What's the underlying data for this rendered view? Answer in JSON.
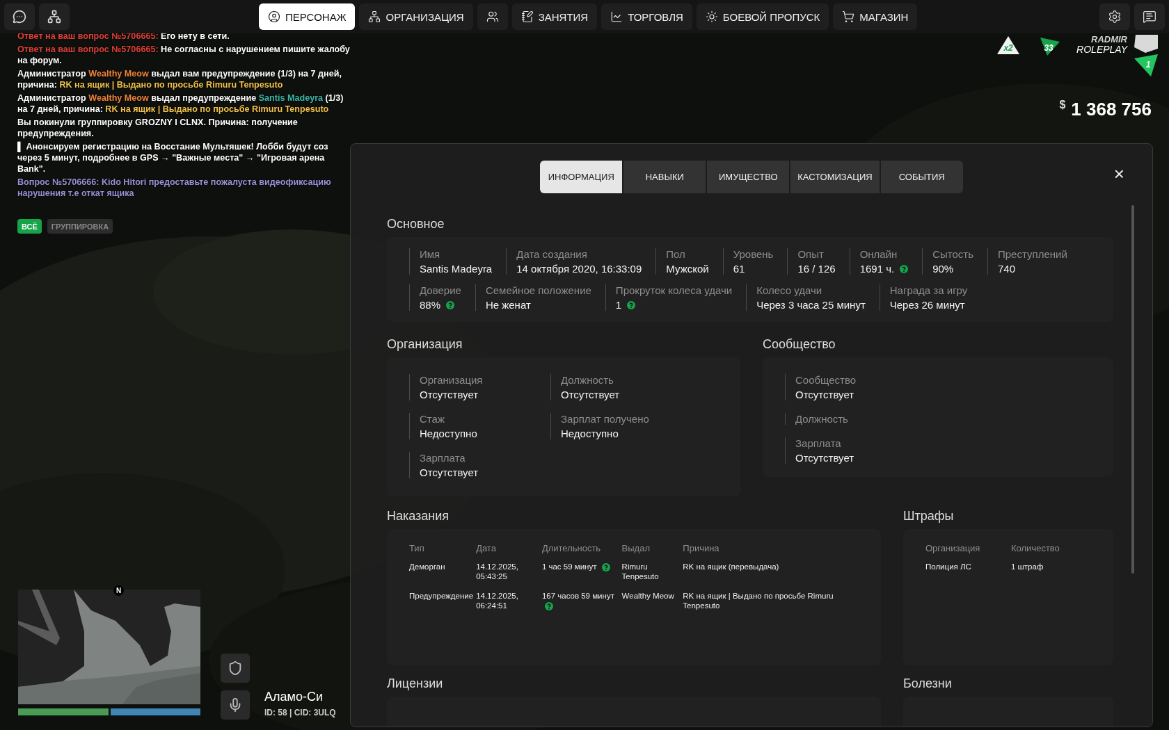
{
  "top_bar": {
    "nav": [
      {
        "label": "ПЕРСОНАЖ",
        "selected": true
      },
      {
        "label": "ОРГАНИЗАЦИЯ",
        "selected": false
      },
      {
        "selected": false
      },
      {
        "label": "ЗАНЯТИЯ",
        "selected": false
      },
      {
        "label": "ТОРГОВЛЯ",
        "selected": false
      },
      {
        "label": "БОЕВОЙ ПРОПУСК",
        "selected": false
      },
      {
        "label": "МАГАЗИН",
        "selected": false
      }
    ]
  },
  "chat": {
    "messages": [
      {
        "lines": [
          [
            {
              "text": "Ответ на ваш вопрос №5706665:",
              "color": "#e0403a"
            },
            {
              "text": " Его нету в сети.",
              "color": "#ffffff"
            }
          ]
        ]
      },
      {
        "lines": [
          [
            {
              "text": "Ответ на ваш вопрос №5706665:",
              "color": "#e0403a"
            },
            {
              "text": " Не согласны с нарушением пишите жалобу",
              "color": "#ffffff"
            }
          ],
          [
            {
              "text": "на форум.",
              "color": "#ffffff"
            }
          ]
        ]
      },
      {
        "lines": [
          [
            {
              "text": "Администратор ",
              "color": "#ffffff"
            },
            {
              "text": "Wealthy Meow",
              "color": "#f0823a"
            },
            {
              "text": " выдал вам предупреждение (1/3) на 7 дней,",
              "color": "#ffffff"
            }
          ],
          [
            {
              "text": "причина: ",
              "color": "#ffffff"
            },
            {
              "text": "RK на ящик | Выдано по просьбе Rimuru Tenpesuto",
              "color": "#f2c14a"
            }
          ]
        ]
      },
      {
        "lines": [
          [
            {
              "text": "Администратор ",
              "color": "#ffffff"
            },
            {
              "text": "Wealthy Meow",
              "color": "#f0823a"
            },
            {
              "text": " выдал предупреждение ",
              "color": "#ffffff"
            },
            {
              "text": "Santis Madeyra",
              "color": "#3bb7a4"
            },
            {
              "text": " (1/3)",
              "color": "#ffffff"
            }
          ],
          [
            {
              "text": "на 7 дней, причина: ",
              "color": "#ffffff"
            },
            {
              "text": "RK на ящик | Выдано по просьбе Rimuru Tenpesuto",
              "color": "#f2c14a"
            }
          ]
        ]
      },
      {
        "lines": [
          [
            {
              "text": "Вы покинули группировку GROZNY I CLNX. Причина: получение",
              "color": "#ffffff"
            }
          ],
          [
            {
              "text": "предупреждения.",
              "color": "#ffffff"
            }
          ]
        ]
      },
      {
        "lines": [
          [
            {
              "text": "▌ Анонсируем регистрацию на Восстание Мультяшек! Лобби будут соз",
              "color": "#ffffff"
            }
          ],
          [
            {
              "text": "через 5 минут, подробнее в GPS → \"Важные места\" → \"Игровая арена",
              "color": "#ffffff"
            }
          ],
          [
            {
              "text": "Bank\".",
              "color": "#ffffff"
            }
          ]
        ]
      },
      {
        "lines": [
          [
            {
              "text": "Вопрос №5706666: Kido Hitori предоставьте пожалуста видеофиксацию",
              "color": "#9b8fd6"
            }
          ],
          [
            {
              "text": "нарушения т.е откат ящика",
              "color": "#9b8fd6"
            }
          ]
        ]
      }
    ],
    "filters": [
      {
        "label": "ВСЁ",
        "selected": true
      },
      {
        "label": "ГРУППИРОВКА",
        "selected": false
      }
    ]
  },
  "server": {
    "bonus": "x2",
    "online": "33",
    "brand": "RADMIR",
    "brand_sub": "ROLEPLAY",
    "server_number": "1"
  },
  "money": {
    "currency": "$",
    "amount": "1 368 756"
  },
  "panel": {
    "tabs": [
      {
        "label": "ИНФОРМАЦИЯ",
        "selected": true
      },
      {
        "label": "НАВЫКИ",
        "selected": false
      },
      {
        "label": "ИМУЩЕСТВО",
        "selected": false
      },
      {
        "label": "КАСТОМИЗАЦИЯ",
        "selected": false
      },
      {
        "label": "СОБЫТИЯ",
        "selected": false
      }
    ],
    "close": "×",
    "main": {
      "title": "Основное",
      "lines": [
        {
          "fields": [
            {
              "label": "Имя",
              "value": "Santis Madeyra",
              "hint": false
            },
            {
              "label": "Дата создания",
              "value": "14 октября 2020, 16:33:09",
              "hint": false
            },
            {
              "label": "Пол",
              "value": "Мужской",
              "hint": false
            },
            {
              "label": "Уровень",
              "value": "61",
              "hint": false
            },
            {
              "label": "Опыт",
              "value": "16 / 126",
              "hint": false
            },
            {
              "label": "Онлайн",
              "value": "1691 ч.",
              "hint": true
            },
            {
              "label": "Сытость",
              "value": "90%",
              "hint": false
            },
            {
              "label": "Преступлений",
              "value": "740",
              "hint": false
            }
          ]
        },
        {
          "fields": [
            {
              "label": "Доверие",
              "value": "88%",
              "hint": true
            },
            {
              "label": "Семейное положение",
              "value": "Не женат",
              "hint": false
            },
            {
              "label": "Прокруток колеса удачи",
              "value": "1",
              "hint": true
            },
            {
              "label": "Колесо удачи",
              "value": "Через 3 часа 25 минут",
              "hint": false
            },
            {
              "label": "Награда за игру",
              "value": "Через 26 минут",
              "hint": false
            }
          ]
        }
      ]
    },
    "organization": {
      "title": "Организация",
      "fields": [
        {
          "label": "Организация",
          "value": "Отсутствует"
        },
        {
          "label": "Должность",
          "value": "Отсутствует"
        },
        {
          "label": "Стаж",
          "value": "Недоступно"
        },
        {
          "label": "Зарплат получено",
          "value": "Недоступно"
        },
        {
          "label": "Зарплата",
          "value": "Отсутствует"
        }
      ]
    },
    "community": {
      "title": "Сообщество",
      "fields": [
        {
          "label": "Сообщество",
          "value": "Отсутствует"
        },
        {
          "label": "Должность"
        },
        {
          "label": "Зарплата",
          "value": "Отсутствует"
        }
      ]
    },
    "punishments": {
      "title": "Наказания",
      "columns": [
        "Тип",
        "Дата",
        "Длительность",
        "Выдал",
        "Причина"
      ],
      "rows": [
        {
          "type": "Деморган",
          "date": "14.12.2025, 05:43:25",
          "duration": "1 час 59 минут",
          "hint": true,
          "issuer": "Rimuru Tenpesuto",
          "reason": "RK на ящик (перевыдача)"
        },
        {
          "type": "Предупреждение",
          "date": "14.12.2025, 06:24:51",
          "duration": "167 часов 59 минут",
          "hint": true,
          "issuer": "Wealthy Meow",
          "reason": "RK на ящик | Выдано по просьбе Rimuru Tenpesuto"
        }
      ]
    },
    "fines": {
      "title": "Штрафы",
      "columns": [
        "Организация",
        "Количество"
      ],
      "rows": [
        [
          "Полиция ЛС",
          "1 штраф"
        ]
      ]
    },
    "licenses": {
      "title": "Лицензии"
    },
    "diseases": {
      "title": "Болезни"
    }
  },
  "hud": {
    "minimap": {
      "north": "N",
      "bars": [
        {
          "kind": "health",
          "level": 1
        },
        {
          "kind": "armor",
          "level": 1
        }
      ]
    },
    "location": "Аламо-Си",
    "player_info": "ID: 58 | CID: 3ULQ"
  }
}
